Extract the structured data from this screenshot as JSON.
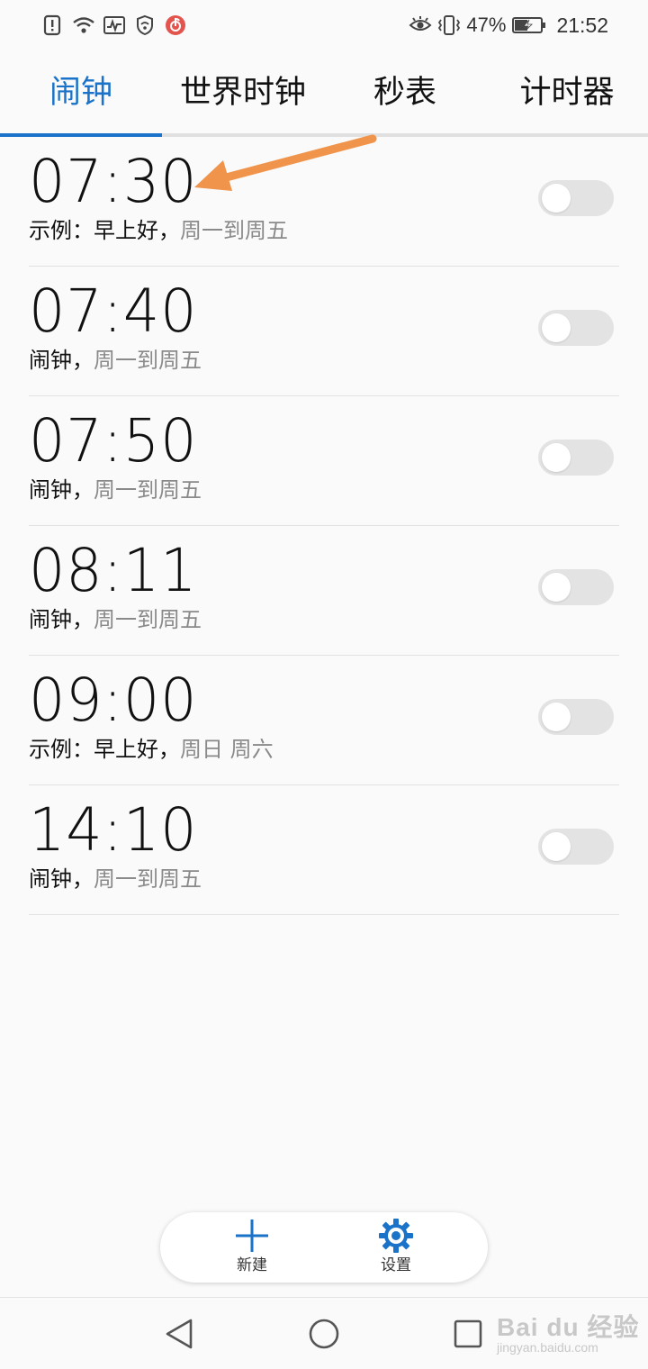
{
  "status_bar": {
    "battery_percent": "47%",
    "time": "21:52",
    "icons": [
      "notification-icon",
      "wifi-icon",
      "activity-icon",
      "vpn-shield-icon",
      "netease-music-icon",
      "eye-comfort-icon",
      "vibrate-icon",
      "battery-charging-icon"
    ]
  },
  "tabs": [
    {
      "label": "闹钟",
      "active": true
    },
    {
      "label": "世界时钟",
      "active": false
    },
    {
      "label": "秒表",
      "active": false
    },
    {
      "label": "计时器",
      "active": false
    }
  ],
  "alarms": [
    {
      "time": "07:30",
      "label": "示例：早上好",
      "sep": "，",
      "repeat": "周一到周五",
      "enabled": false
    },
    {
      "time": "07:40",
      "label": "闹钟",
      "sep": "，",
      "repeat": "周一到周五",
      "enabled": false
    },
    {
      "time": "07:50",
      "label": "闹钟",
      "sep": "，",
      "repeat": "周一到周五",
      "enabled": false
    },
    {
      "time": "08:11",
      "label": "闹钟",
      "sep": "，",
      "repeat": "周一到周五",
      "enabled": false
    },
    {
      "time": "09:00",
      "label": "示例：早上好",
      "sep": "，",
      "repeat": "周日 周六",
      "enabled": false
    },
    {
      "time": "14:10",
      "label": "闹钟",
      "sep": "，",
      "repeat": "周一到周五",
      "enabled": false
    }
  ],
  "actions": {
    "new_label": "新建",
    "settings_label": "设置"
  },
  "colors": {
    "accent": "#1a73c8",
    "annotation": "#f0944b",
    "toggle_off": "#e3e3e3"
  },
  "watermark": {
    "main": "Bai du 经验",
    "sub": "jingyan.baidu.com"
  }
}
